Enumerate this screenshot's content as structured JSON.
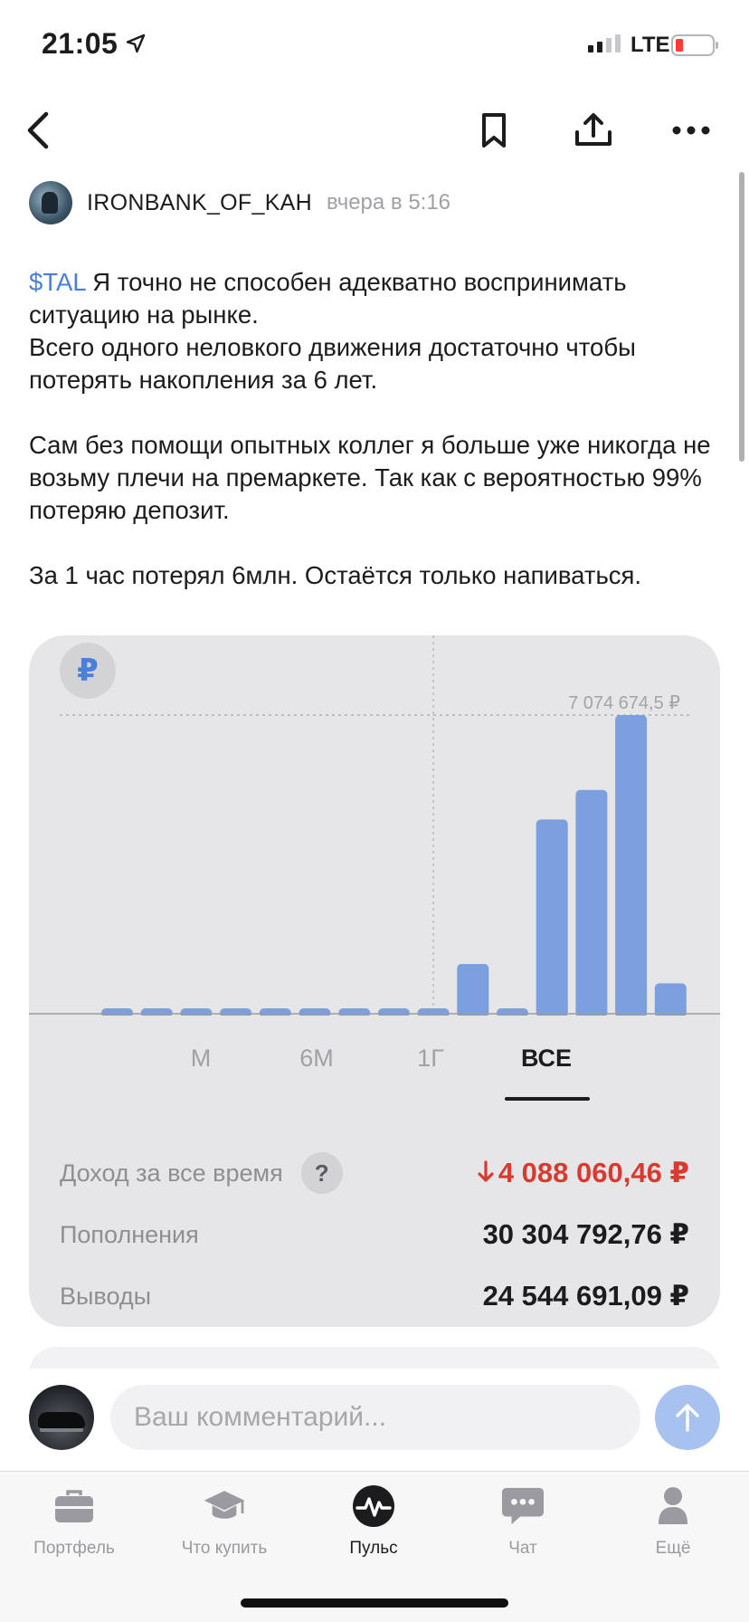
{
  "status_bar": {
    "time": "21:05",
    "network": "LTE"
  },
  "post": {
    "author": "IRONBANK_OF_KAH",
    "time": "вчера в 5:16",
    "ticker": "$TAL",
    "paragraphs": [
      " Я точно не способен адекватно воспринимать ситуацию на рынке.\nВсего одного неловкого движения достаточно чтобы потерять накопления за 6 лет.",
      "Сам без помощи опытных коллег я больше уже никогда не возьму плечи на премаркете. Так как с вероятностью 99% потеряю депозит.",
      "За 1 час потерял 6млн. Остаётся только напиваться."
    ]
  },
  "card": {
    "currency_badge": "₽",
    "max_label": "7 074 674,5 ₽",
    "periods": [
      "М",
      "6М",
      "1Г",
      "ВСЕ"
    ],
    "active_period": "ВСЕ",
    "stats": [
      {
        "label": "Доход за все время",
        "value": "4 088 060,46 ₽",
        "negative": true,
        "help": "?"
      },
      {
        "label": "Пополнения",
        "value": "30 304 792,76 ₽",
        "negative": false
      },
      {
        "label": "Выводы",
        "value": "24 544 691,09 ₽",
        "negative": false
      }
    ]
  },
  "chart_data": {
    "type": "bar",
    "title": "",
    "xlabel": "",
    "ylabel": "",
    "max_value_label": "7 074 674,5 ₽",
    "values": [
      80000,
      80000,
      80000,
      80000,
      80000,
      80000,
      80000,
      80000,
      80000,
      1180000,
      80000,
      4600000,
      5300000,
      7074674.5,
      720000
    ],
    "ylim": [
      0,
      7074674.5
    ],
    "color": "#7b9fdf",
    "grid": false
  },
  "comment": {
    "placeholder": "Ваш комментарий..."
  },
  "tabs": [
    {
      "label": "Портфель",
      "icon": "briefcase-icon",
      "active": false
    },
    {
      "label": "Что купить",
      "icon": "graduation-cap-icon",
      "active": false
    },
    {
      "label": "Пульс",
      "icon": "pulse-icon",
      "active": true
    },
    {
      "label": "Чат",
      "icon": "chat-icon",
      "active": false
    },
    {
      "label": "Ещё",
      "icon": "profile-icon",
      "active": false
    }
  ],
  "colors": {
    "accent": "#4a7fd6",
    "bar": "#7b9fdf",
    "negative": "#d93a2f",
    "card_bg": "#e6e6e8"
  }
}
